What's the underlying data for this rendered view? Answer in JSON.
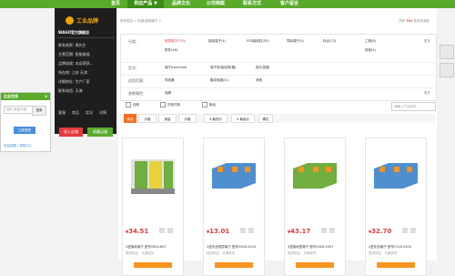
{
  "nav": {
    "items": [
      "首页",
      "供应产品 ▼",
      "品牌文化",
      "公司档案",
      "联系方式",
      "客户留言"
    ],
    "active_index": 1
  },
  "shop": {
    "logo_text": "工业品牌",
    "shop_name": "WAGO官方旗舰店",
    "rows": [
      "联系商家: 周先生",
      "主营范围: 智能接插",
      "品牌成就: 本店荣获...",
      "所在地: 江苏 天津",
      "详细地址: 生产厂家",
      "联系电话: 天津"
    ],
    "tabs": [
      "客服",
      "商品",
      "实况",
      "详情"
    ],
    "btn_enter": "进入店铺",
    "btn_fav": "收藏店铺"
  },
  "side": {
    "title": "企业在线",
    "close": "x",
    "input_placeholder": "您好,欢迎光临",
    "go": "搜索",
    "login": "立即登录",
    "footer": "欢迎观看 | 帮助中心"
  },
  "breadcrumb": "所有类目 > 电源/接线端子 >",
  "found": {
    "prefix": "共有",
    "count": "791",
    "suffix": "件相关商品"
  },
  "filters": [
    {
      "label": "分类:",
      "options": [
        "电源端子(791)",
        "接线端子(4)",
        "PCB接线柱(55)",
        "导轨端子(4)",
        "标记(13)",
        "工具(8)",
        "附件(46)",
        "其他(4)"
      ],
      "selected": 0,
      "more": "更多"
    },
    {
      "label": "型号:",
      "options": [
        "端子(terminal)",
        "端子排/接线排(箱)",
        "插头/插座"
      ],
      "selected": -1,
      "more": ""
    },
    {
      "label": "适用范围:",
      "options": [
        "导线器",
        "集成电路(IC)",
        "其他"
      ],
      "selected": -1,
      "more": ""
    },
    {
      "label": "参数属性:",
      "options": [
        "品牌"
      ],
      "selected": -1,
      "more": "更多"
    }
  ],
  "checks": [
    "包邮",
    "货到付款",
    "新品"
  ],
  "search_placeholder": "请输入产品名称",
  "sort": [
    "综合",
    "价格",
    "销量",
    "价格",
    "¥ 最低价",
    "¥ 最高价",
    "确定"
  ],
  "products": [
    {
      "price_symbol": "¥",
      "price": "34.51",
      "name": "2进接地端子,型号2004-607",
      "stock": "现货供应 · 天津发货",
      "color": "#6fae3f"
    },
    {
      "price_symbol": "¥",
      "price": "13.01",
      "name": "2进灰色双层端子,型号2006-5204",
      "stock": "现货供应 · 天津发货",
      "color": "#4f8ecf"
    },
    {
      "price_symbol": "¥",
      "price": "43.17",
      "name": "3进接地型端子,型号2006-5307",
      "stock": "现货供应 · 天津发货",
      "color": "#6fae3f"
    },
    {
      "price_symbol": "¥",
      "price": "32.70",
      "name": "2进灰色端子,型号2116-5304",
      "stock": "现货供应 · 天津发货",
      "color": "#4f8ecf"
    }
  ],
  "colors": {
    "nav": "#5aab2c",
    "accent": "#e4393c",
    "orange": "#f37020"
  }
}
